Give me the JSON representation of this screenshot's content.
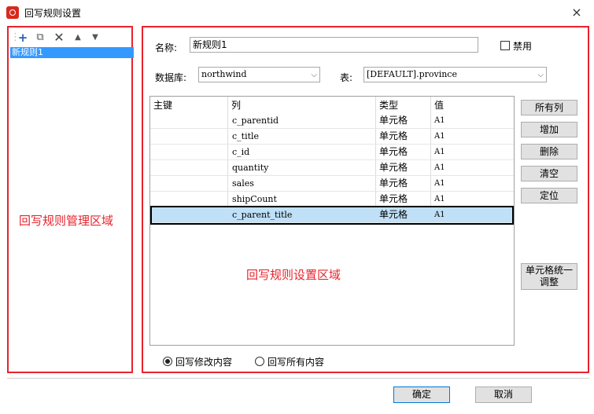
{
  "window": {
    "title": "回写规则设置",
    "close": "×"
  },
  "left_panel": {
    "toolbar": [
      "add-icon",
      "copy-icon",
      "delete-icon",
      "move-up-icon",
      "move-down-icon"
    ],
    "rules": [
      "新规则1"
    ],
    "annotation": "回写规则管理区域"
  },
  "form": {
    "name_label": "名称:",
    "name_value": "新规则1",
    "disable_label": "禁用",
    "database_label": "数据库:",
    "database_value": "northwind",
    "table_label": "表:",
    "table_value": "[DEFAULT].province"
  },
  "grid": {
    "headers": [
      "主键",
      "列",
      "类型",
      "值"
    ],
    "rows": [
      {
        "key": "",
        "column": "c_parentid",
        "type": "单元格",
        "value": "A1"
      },
      {
        "key": "",
        "column": "c_title",
        "type": "单元格",
        "value": "A1"
      },
      {
        "key": "",
        "column": "c_id",
        "type": "单元格",
        "value": "A1"
      },
      {
        "key": "",
        "column": "quantity",
        "type": "单元格",
        "value": "A1"
      },
      {
        "key": "",
        "column": "sales",
        "type": "单元格",
        "value": "A1"
      },
      {
        "key": "",
        "column": "shipCount",
        "type": "单元格",
        "value": "A1"
      },
      {
        "key": "",
        "column": "c_parent_title",
        "type": "单元格",
        "value": "A1"
      }
    ]
  },
  "side_buttons": {
    "all_columns": "所有列",
    "add": "增加",
    "delete": "删除",
    "clear": "清空",
    "locate": "定位",
    "uniform_adjust": "单元格统一调整"
  },
  "annotation_right": "回写规则设置区域",
  "radios": {
    "modified": "回写修改内容",
    "all": "回写所有内容"
  },
  "dialog_buttons": {
    "ok": "确定",
    "cancel": "取消"
  }
}
